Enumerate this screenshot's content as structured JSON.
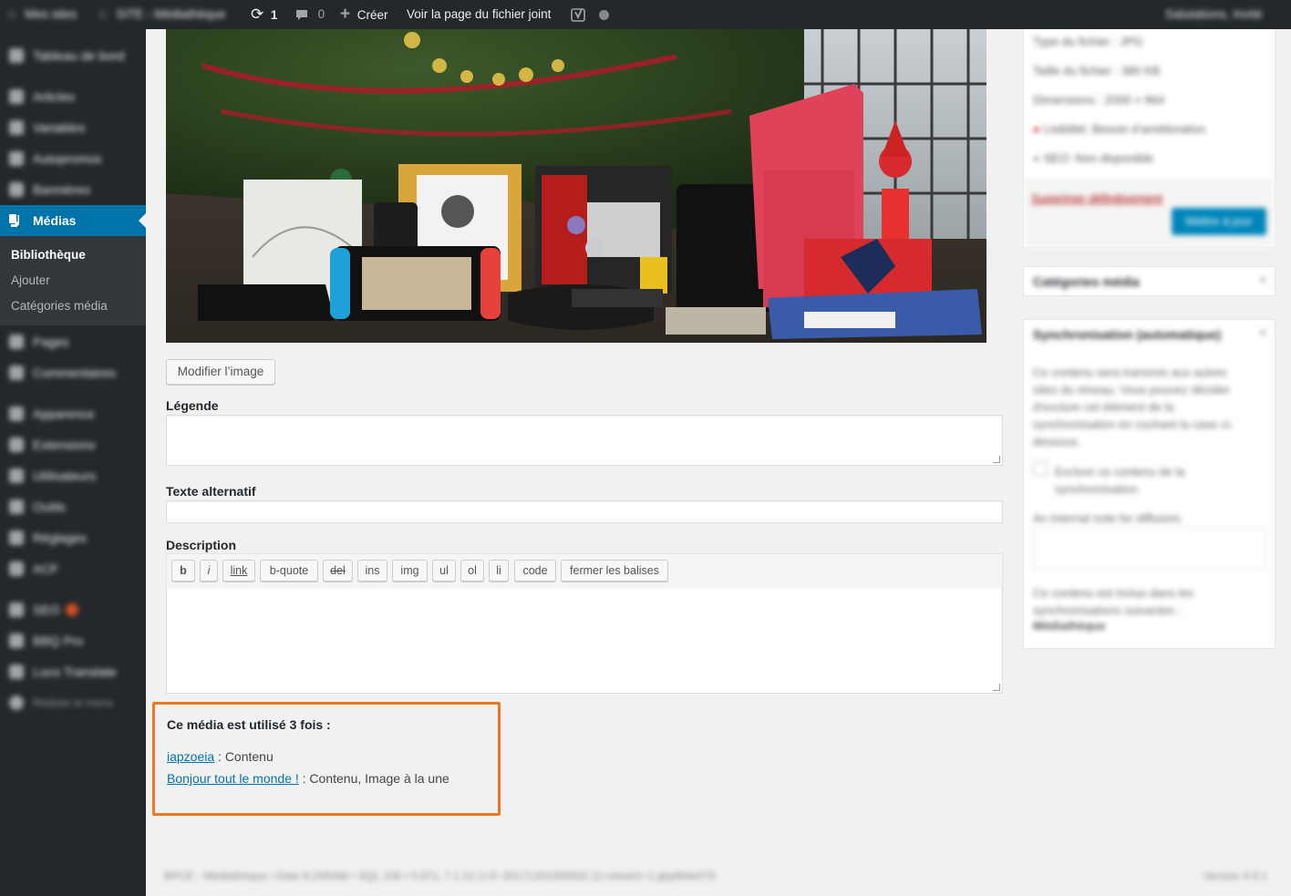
{
  "admin_bar": {
    "sites_label": "Mes sites",
    "site_name": "SITE - Médiathèque",
    "updates_count": "1",
    "comments_count": "0",
    "new_label": "Créer",
    "view_attachment_label": "Voir la page du fichier joint",
    "account_label": "Salutations, Invité",
    "icons": [
      "wordpress-icon",
      "home-icon",
      "update-icon",
      "comment-icon",
      "plus-icon",
      "yoast-icon",
      "status-dot-icon"
    ]
  },
  "sidebar": {
    "items": [
      {
        "label": "Tableau de bord",
        "icon": "dashboard-icon"
      },
      {
        "label": "Articles",
        "icon": "pin-icon"
      },
      {
        "label": "Variables",
        "icon": "variables-icon"
      },
      {
        "label": "Autopromos",
        "icon": "autopromo-icon"
      },
      {
        "label": "Bannières",
        "icon": "banner-icon"
      },
      {
        "label": "Médias",
        "icon": "media-icon"
      },
      {
        "label": "Pages",
        "icon": "pages-icon"
      },
      {
        "label": "Commentaires",
        "icon": "comments-icon"
      },
      {
        "label": "Apparence",
        "icon": "appearance-icon"
      },
      {
        "label": "Extensions",
        "icon": "plugins-icon"
      },
      {
        "label": "Utilisateurs",
        "icon": "users-icon"
      },
      {
        "label": "Outils",
        "icon": "tools-icon"
      },
      {
        "label": "Réglages",
        "icon": "settings-icon"
      },
      {
        "label": "ACF",
        "icon": "acf-icon"
      },
      {
        "label": "SEO",
        "icon": "seo-icon"
      },
      {
        "label": "BBQ Pro",
        "icon": "bbq-icon"
      },
      {
        "label": "Loco Translate",
        "icon": "loco-icon"
      },
      {
        "label": "Réduire le menu",
        "icon": "collapse-icon"
      }
    ],
    "current": "Médias",
    "submenu": [
      "Bibliothèque",
      "Ajouter",
      "Catégories média"
    ],
    "submenu_current": "Bibliothèque"
  },
  "editor": {
    "edit_image_button": "Modifier l’image",
    "caption_label": "Légende",
    "caption_value": "",
    "alt_label": "Texte alternatif",
    "alt_value": "",
    "description_label": "Description",
    "description_value": "",
    "quicktags": [
      "b",
      "i",
      "link",
      "b-quote",
      "del",
      "ins",
      "img",
      "ul",
      "ol",
      "li",
      "code",
      "fermer les balises"
    ]
  },
  "usage": {
    "title": "Ce média est utilisé 3 fois :",
    "entries": [
      {
        "link": "iapzoeia",
        "detail": " : Contenu"
      },
      {
        "link": "Bonjour tout le monde !",
        "detail": " : Contenu, Image à la une"
      }
    ],
    "highlight_color": "#f07722"
  },
  "side_panel": {
    "file_type": "Type du fichier : JPG",
    "file_size": "Taille du fichier : 380 KB",
    "dimensions": "Dimensions : 2000 × 864",
    "readability": "Lisibilité: Besoin d’amélioration",
    "seo": "SEO: Non disponible",
    "delete_link": "Supprimer définitivement",
    "update_button": "Mettre à jour",
    "categories_title": "Catégories média",
    "sync_title": "Synchronisation (automatique)",
    "sync_text": "Ce contenu sera transmis aux autres sites du réseau. Vous pouvez décider d’exclure cet élément de la synchronisation en cochant la case ci-dessous.",
    "exclude_label": "Exclure ce contenu de la synchronisation.",
    "internal_note_label": "An internal note for diffusion.",
    "included_text": "Ce contenu est inclus dans les synchronisations suivantes :",
    "included_value": "Médiathèque"
  },
  "footer": {
    "left": "BPCE - Médiathèque • Date 8.20RAM • SQL 106 • 0.67s, 7.1.12-1+0~20171201000002.11+stretch~1.gbpf64e075",
    "right": "Version 4.9.1"
  },
  "colors": {
    "admin_bar": "#23282d",
    "accent": "#0073aa",
    "link": "#0073aa",
    "highlight": "#f07722"
  }
}
